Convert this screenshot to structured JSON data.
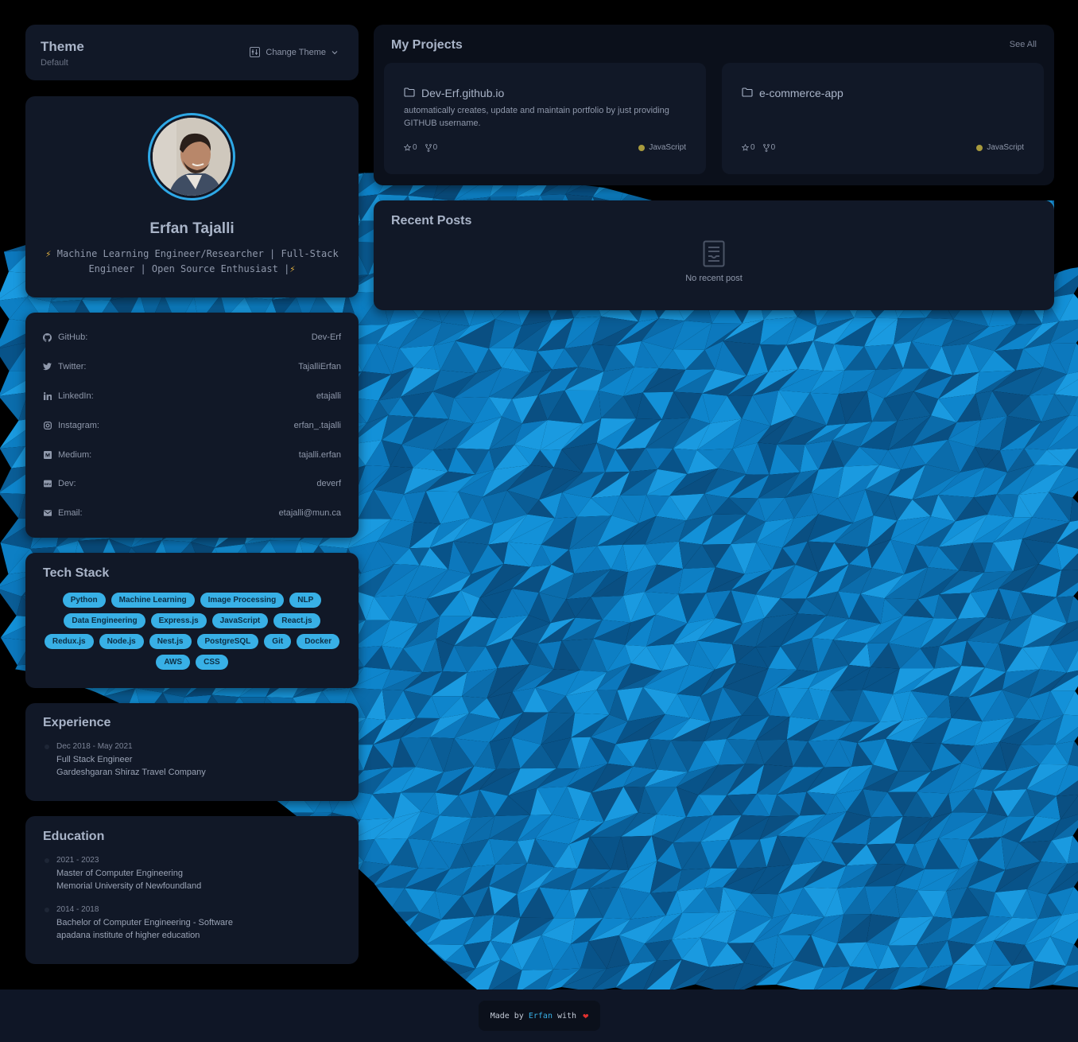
{
  "theme": {
    "title": "Theme",
    "current": "Default",
    "change_label": "Change Theme"
  },
  "profile": {
    "name": "Erfan Tajalli",
    "bio_line1": " Machine Learning Engineer/Researcher | Full-Stack",
    "bio_line2": "Engineer | Open Source Enthusiast |",
    "bolt": "⚡"
  },
  "socials": [
    {
      "label": "GitHub:",
      "value": "Dev-Erf",
      "icon": "github-icon"
    },
    {
      "label": "Twitter:",
      "value": "TajalliErfan",
      "icon": "twitter-icon"
    },
    {
      "label": "LinkedIn:",
      "value": "etajalli",
      "icon": "linkedin-icon"
    },
    {
      "label": "Instagram:",
      "value": "erfan_.tajalli",
      "icon": "instagram-icon"
    },
    {
      "label": "Medium:",
      "value": "tajalli.erfan",
      "icon": "medium-icon"
    },
    {
      "label": "Dev:",
      "value": "deverf",
      "icon": "dev-icon"
    },
    {
      "label": "Email:",
      "value": "etajalli@mun.ca",
      "icon": "email-icon"
    }
  ],
  "tech_stack": {
    "title": "Tech Stack",
    "items": [
      "Python",
      "Machine Learning",
      "Image Processing",
      "NLP",
      "Data Engineering",
      "Express.js",
      "JavaScript",
      "React.js",
      "Redux.js",
      "Node.js",
      "Nest.js",
      "PostgreSQL",
      "Git",
      "Docker",
      "AWS",
      "CSS"
    ]
  },
  "experience": {
    "title": "Experience",
    "items": [
      {
        "date": "Dec 2018 - May 2021",
        "role": "Full Stack Engineer",
        "org": "Gardeshgaran Shiraz Travel Company"
      }
    ]
  },
  "education": {
    "title": "Education",
    "items": [
      {
        "date": "2021 - 2023",
        "degree": "Master of Computer Engineering",
        "school": "Memorial University of Newfoundland"
      },
      {
        "date": "2014 - 2018",
        "degree": "Bachelor of Computer Engineering - Software",
        "school": "apadana institute of higher education"
      }
    ]
  },
  "projects": {
    "title": "My Projects",
    "see_all": "See All",
    "items": [
      {
        "name": "Dev-Erf.github.io",
        "description": "automatically creates, update and maintain portfolio by just providing GITHUB username.",
        "stars": "0",
        "forks": "0",
        "language": "JavaScript",
        "language_color": "#a89a3d"
      },
      {
        "name": "e-commerce-app",
        "description": "",
        "stars": "0",
        "forks": "0",
        "language": "JavaScript",
        "language_color": "#a89a3d"
      }
    ]
  },
  "posts": {
    "title": "Recent Posts",
    "empty_text": "No recent post"
  },
  "footer": {
    "made_by": "Made by ",
    "author": "Erfan",
    "with": " with",
    "heart": "❤"
  },
  "colors": {
    "accent": "#38b0e6",
    "card_bg": "#111827",
    "page_bg": "#000000"
  }
}
